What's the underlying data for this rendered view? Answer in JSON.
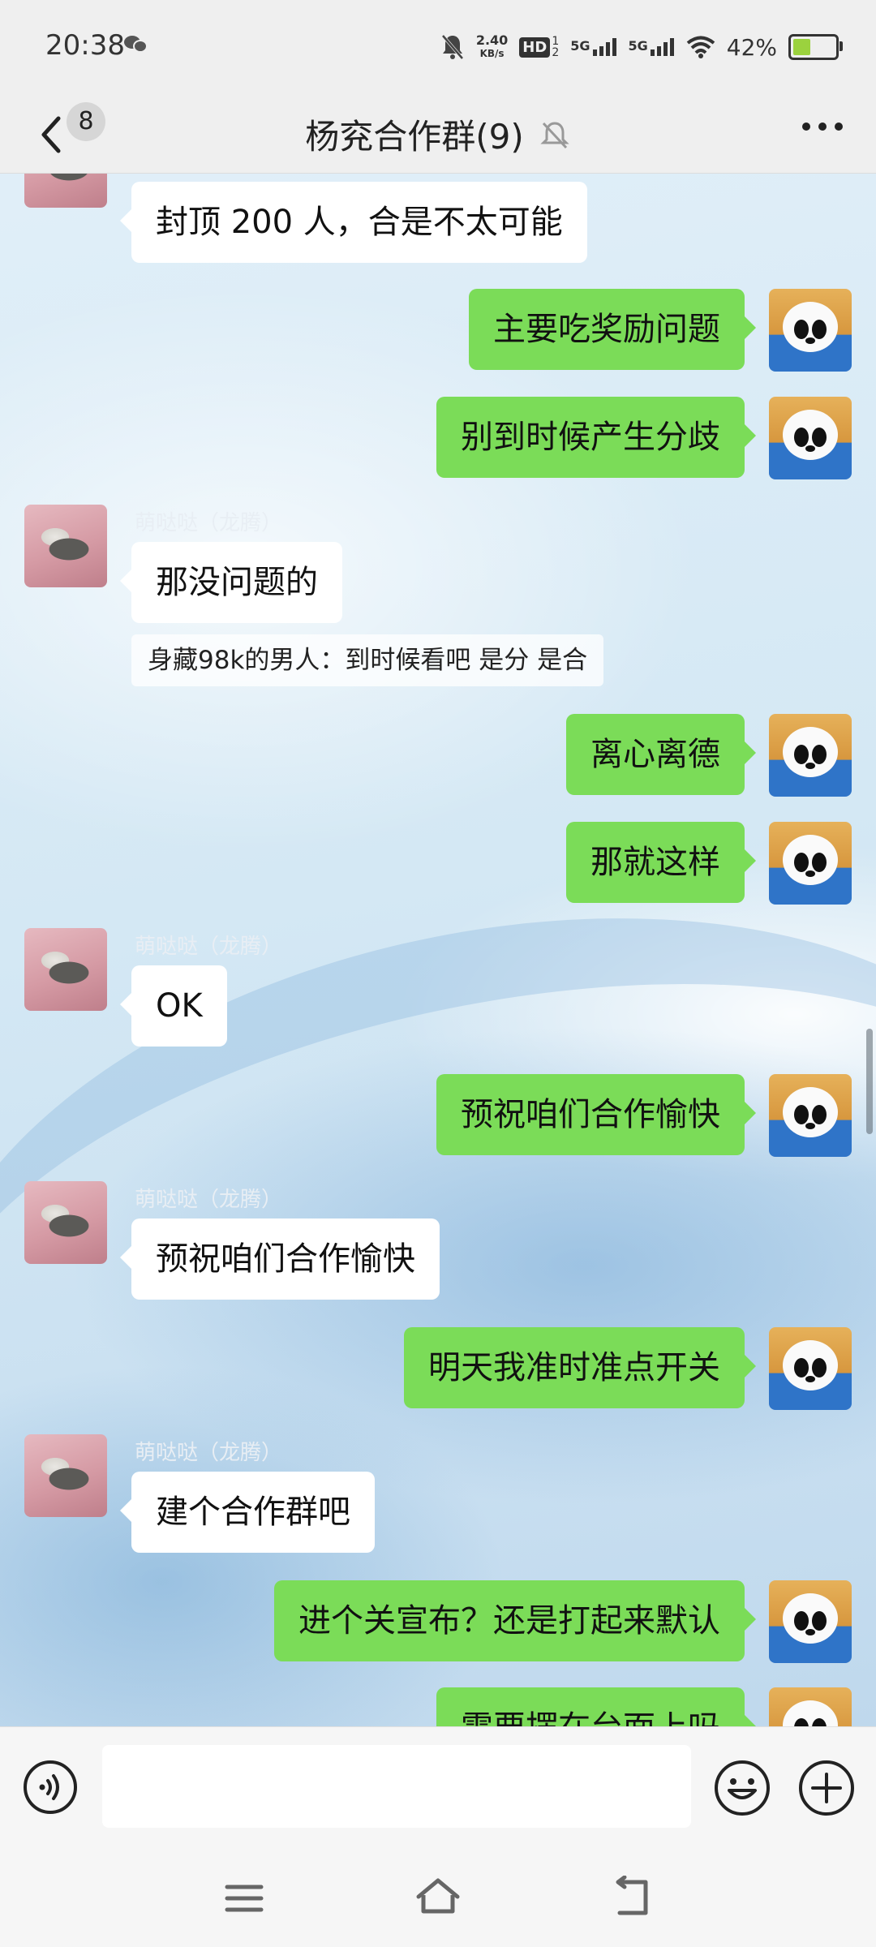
{
  "status_bar": {
    "time": "20:38",
    "net_speed_value": "2.40",
    "net_speed_unit": "KB/s",
    "hd_label": "HD",
    "sim1_label": "5G",
    "sim2_label": "5G",
    "battery_percent": "42%",
    "battery_level": 0.42
  },
  "header": {
    "unread_count": "8",
    "title": "杨兖合作群(9)"
  },
  "messages": [
    {
      "dir": "in",
      "text": "封顶 200 人，合是不太可能"
    },
    {
      "dir": "out",
      "text": "主要吃奖励问题"
    },
    {
      "dir": "out",
      "text": "别到时候产生分歧"
    },
    {
      "dir": "in",
      "sender": "萌哒哒（龙腾）",
      "text": "那没问题的",
      "quote": "身藏98k的男人：到时候看吧 是分 是合"
    },
    {
      "dir": "out",
      "text": "离心离德"
    },
    {
      "dir": "out",
      "text": "那就这样"
    },
    {
      "dir": "in",
      "sender": "萌哒哒（龙腾）",
      "text": "OK"
    },
    {
      "dir": "out",
      "text": "预祝咱们合作愉快"
    },
    {
      "dir": "in",
      "sender": "萌哒哒（龙腾）",
      "text": "预祝咱们合作愉快"
    },
    {
      "dir": "out",
      "text": "明天我准时准点开关"
    },
    {
      "dir": "in",
      "sender": "萌哒哒（龙腾）",
      "text": "建个合作群吧"
    },
    {
      "dir": "out",
      "text": "进个关宣布？还是打起来默认"
    },
    {
      "dir": "out",
      "text": "需要摆在台面上吗"
    }
  ],
  "input": {
    "value": "",
    "placeholder": ""
  },
  "colors": {
    "outgoing_bubble": "#7bdc58",
    "incoming_bubble": "#ffffff",
    "bar_background": "#efefef"
  },
  "icons": {
    "back": "chevron-left-icon",
    "mute": "bell-off-icon",
    "more": "more-dots-icon",
    "voice": "voice-icon",
    "emoji": "emoji-icon",
    "plus": "plus-icon"
  }
}
